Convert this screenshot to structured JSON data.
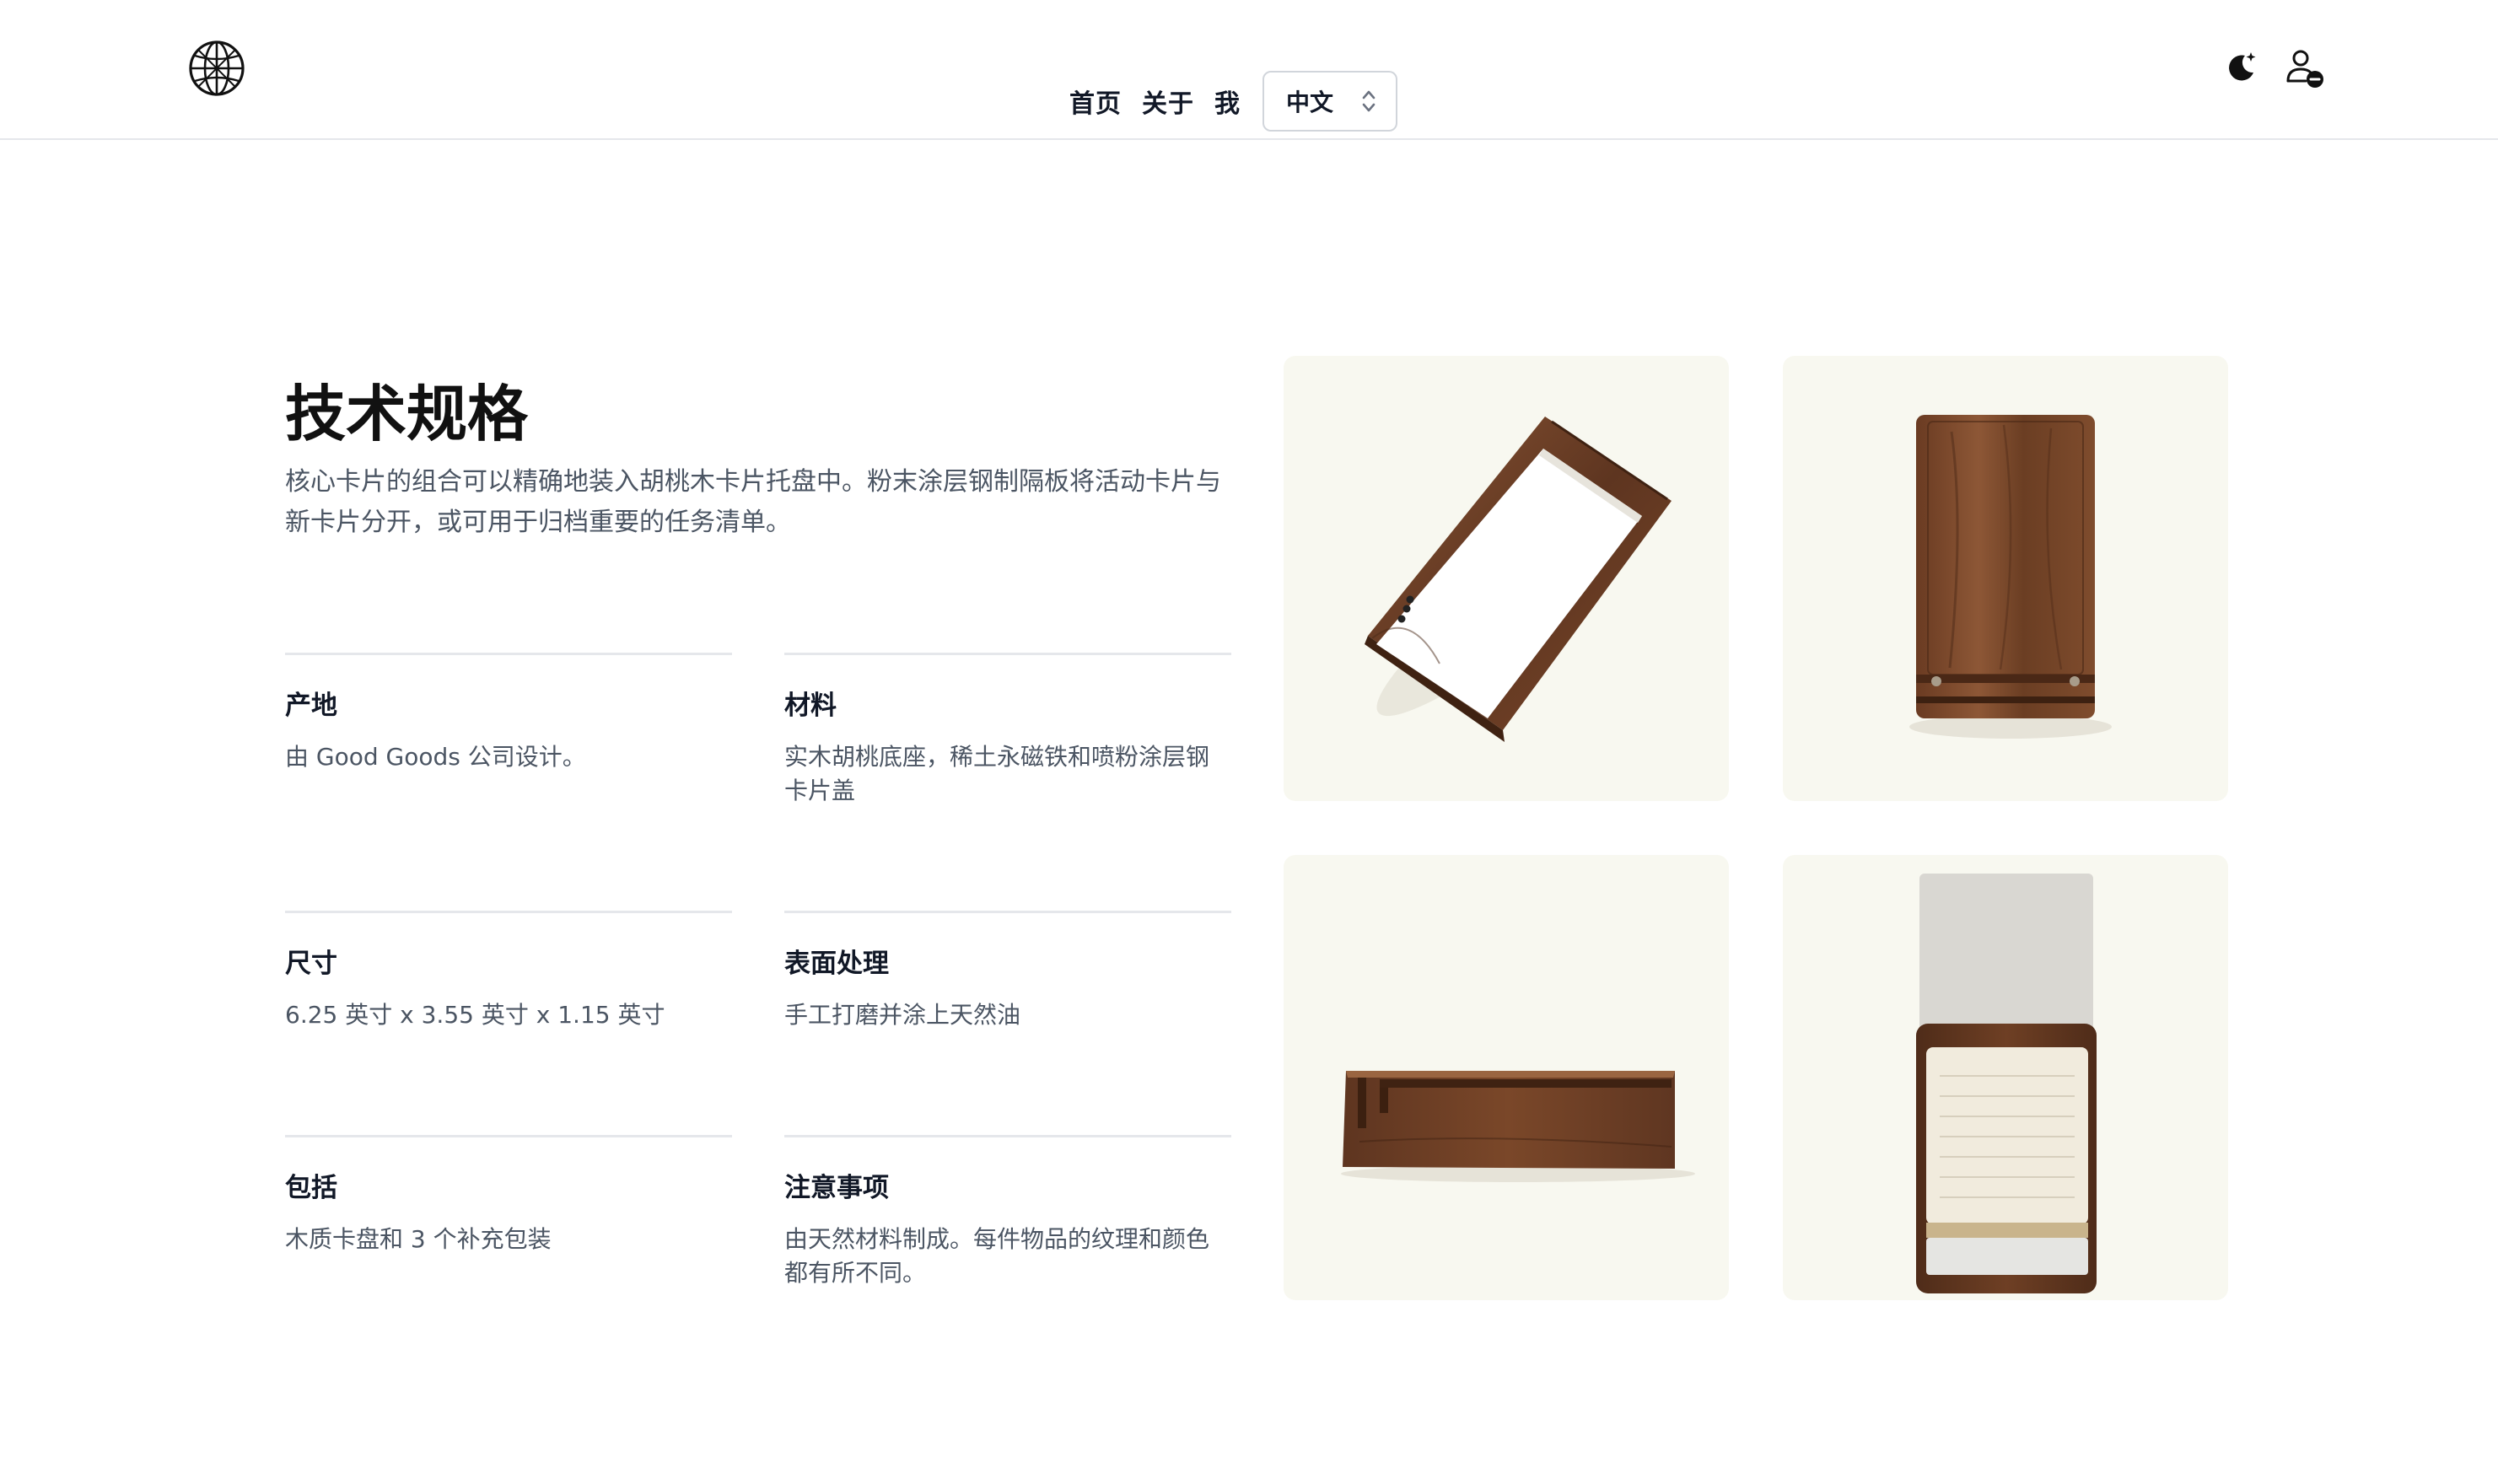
{
  "header": {
    "logo_icon": "globe-logo-icon",
    "nav": {
      "home": "首页",
      "about": "关于",
      "me": "我"
    },
    "language": {
      "selected": "中文",
      "icon": "chevron-up-down-icon"
    },
    "theme_icon": "moon-sparkle-icon",
    "user_icon": "user-minus-icon"
  },
  "main": {
    "title": "技术规格",
    "lead": "核心卡片的组合可以精确地装入胡桃木卡片托盘中。粉末涂层钢制隔板将活动卡片与新卡片分开，或可用于归档重要的任务清单。",
    "specs": [
      {
        "label": "产地",
        "value": "由 Good Goods 公司设计。"
      },
      {
        "label": "材料",
        "value": "实木胡桃底座，稀土永磁铁和喷粉涂层钢卡片盖"
      },
      {
        "label": "尺寸",
        "value": "6.25 英寸 x 3.55 英寸 x 1.15 英寸"
      },
      {
        "label": "表面处理",
        "value": "手工打磨并涂上天然油"
      },
      {
        "label": "包括",
        "value": "木质卡盘和 3 个补充包装"
      },
      {
        "label": "注意事项",
        "value": "由天然材料制成。每件物品的纹理和颜色都有所不同。"
      }
    ],
    "photos": [
      {
        "icon": "walnut-card-tray-angled-image"
      },
      {
        "icon": "walnut-card-tray-top-image"
      },
      {
        "icon": "walnut-card-tray-side-image"
      },
      {
        "icon": "walnut-card-tray-with-cards-image"
      }
    ]
  },
  "colors": {
    "text": "#111827",
    "muted_text": "#4b5563",
    "divider": "#e5e7eb",
    "photo_bg": "#f8f8f0",
    "walnut": "#6b3f24"
  }
}
